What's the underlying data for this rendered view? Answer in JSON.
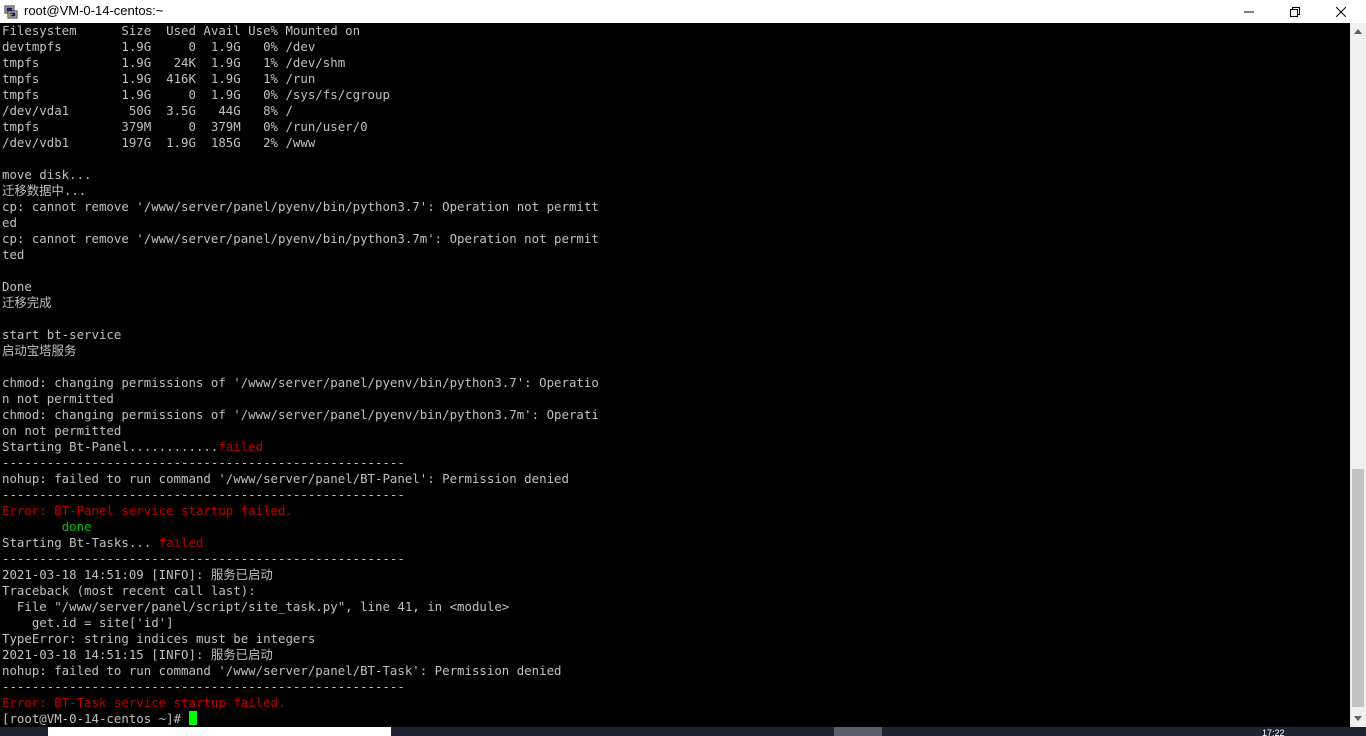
{
  "window": {
    "title": "root@VM-0-14-centos:~",
    "app_icon": "putty-icon",
    "controls": [
      "minimize-icon",
      "maximize-icon",
      "close-icon"
    ]
  },
  "terminal": {
    "colors": {
      "background": "#000000",
      "text": "#c0c0c0",
      "error": "#c00000",
      "success": "#00c000",
      "cursor": "#00ff00"
    },
    "lines": [
      {
        "segments": [
          {
            "t": "Filesystem      Size  Used Avail Use% Mounted on"
          }
        ]
      },
      {
        "segments": [
          {
            "t": "devtmpfs        1.9G     0  1.9G   0% /dev"
          }
        ]
      },
      {
        "segments": [
          {
            "t": "tmpfs           1.9G   24K  1.9G   1% /dev/shm"
          }
        ]
      },
      {
        "segments": [
          {
            "t": "tmpfs           1.9G  416K  1.9G   1% /run"
          }
        ]
      },
      {
        "segments": [
          {
            "t": "tmpfs           1.9G     0  1.9G   0% /sys/fs/cgroup"
          }
        ]
      },
      {
        "segments": [
          {
            "t": "/dev/vda1        50G  3.5G   44G   8% /"
          }
        ]
      },
      {
        "segments": [
          {
            "t": "tmpfs           379M     0  379M   0% /run/user/0"
          }
        ]
      },
      {
        "segments": [
          {
            "t": "/dev/vdb1       197G  1.9G  185G   2% /www"
          }
        ]
      },
      {
        "segments": [
          {
            "t": ""
          }
        ]
      },
      {
        "segments": [
          {
            "t": "move disk..."
          }
        ]
      },
      {
        "segments": [
          {
            "t": "迁移数据中..."
          }
        ]
      },
      {
        "segments": [
          {
            "t": "cp: cannot remove '/www/server/panel/pyenv/bin/python3.7': Operation not permitt"
          }
        ]
      },
      {
        "segments": [
          {
            "t": "ed"
          }
        ]
      },
      {
        "segments": [
          {
            "t": "cp: cannot remove '/www/server/panel/pyenv/bin/python3.7m': Operation not permit"
          }
        ]
      },
      {
        "segments": [
          {
            "t": "ted"
          }
        ]
      },
      {
        "segments": [
          {
            "t": ""
          }
        ]
      },
      {
        "segments": [
          {
            "t": "Done"
          }
        ]
      },
      {
        "segments": [
          {
            "t": "迁移完成"
          }
        ]
      },
      {
        "segments": [
          {
            "t": ""
          }
        ]
      },
      {
        "segments": [
          {
            "t": "start bt-service"
          }
        ]
      },
      {
        "segments": [
          {
            "t": "启动宝塔服务"
          }
        ]
      },
      {
        "segments": [
          {
            "t": ""
          }
        ]
      },
      {
        "segments": [
          {
            "t": "chmod: changing permissions of '/www/server/panel/pyenv/bin/python3.7': Operatio"
          }
        ]
      },
      {
        "segments": [
          {
            "t": "n not permitted"
          }
        ]
      },
      {
        "segments": [
          {
            "t": "chmod: changing permissions of '/www/server/panel/pyenv/bin/python3.7m': Operati"
          }
        ]
      },
      {
        "segments": [
          {
            "t": "on not permitted"
          }
        ]
      },
      {
        "segments": [
          {
            "t": "Starting Bt-Panel............"
          },
          {
            "t": "failed",
            "c": "red"
          }
        ]
      },
      {
        "segments": [
          {
            "t": "------------------------------------------------------"
          }
        ]
      },
      {
        "segments": [
          {
            "t": "nohup: failed to run command '/www/server/panel/BT-Panel': Permission denied"
          }
        ]
      },
      {
        "segments": [
          {
            "t": "------------------------------------------------------"
          }
        ]
      },
      {
        "segments": [
          {
            "t": "Error: BT-Panel service startup failed.",
            "c": "red"
          }
        ]
      },
      {
        "segments": [
          {
            "t": "        "
          },
          {
            "t": "done",
            "c": "green"
          }
        ]
      },
      {
        "segments": [
          {
            "t": "Starting Bt-Tasks... "
          },
          {
            "t": "failed",
            "c": "red"
          }
        ]
      },
      {
        "segments": [
          {
            "t": "------------------------------------------------------"
          }
        ]
      },
      {
        "segments": [
          {
            "t": "2021-03-18 14:51:09 [INFO]: 服务已启动"
          }
        ]
      },
      {
        "segments": [
          {
            "t": "Traceback (most recent call last):"
          }
        ]
      },
      {
        "segments": [
          {
            "t": "  File \"/www/server/panel/script/site_task.py\", line 41, in <module>"
          }
        ]
      },
      {
        "segments": [
          {
            "t": "    get.id = site['id']"
          }
        ]
      },
      {
        "segments": [
          {
            "t": "TypeError: string indices must be integers"
          }
        ]
      },
      {
        "segments": [
          {
            "t": "2021-03-18 14:51:15 [INFO]: 服务已启动"
          }
        ]
      },
      {
        "segments": [
          {
            "t": "nohup: failed to run command '/www/server/panel/BT-Task': Permission denied"
          }
        ]
      },
      {
        "segments": [
          {
            "t": "------------------------------------------------------"
          }
        ]
      },
      {
        "segments": [
          {
            "t": "Error: BT-Task service startup failed.",
            "c": "red"
          }
        ]
      },
      {
        "segments": [
          {
            "t": "[root@VM-0-14-centos ~]# "
          }
        ],
        "cursor": true
      }
    ]
  },
  "scrollbar": {
    "icons": [
      "scroll-up-arrow-icon",
      "scroll-down-arrow-icon"
    ],
    "position_fraction": 0.66
  },
  "taskbar": {
    "clock_partial": "17:22"
  }
}
